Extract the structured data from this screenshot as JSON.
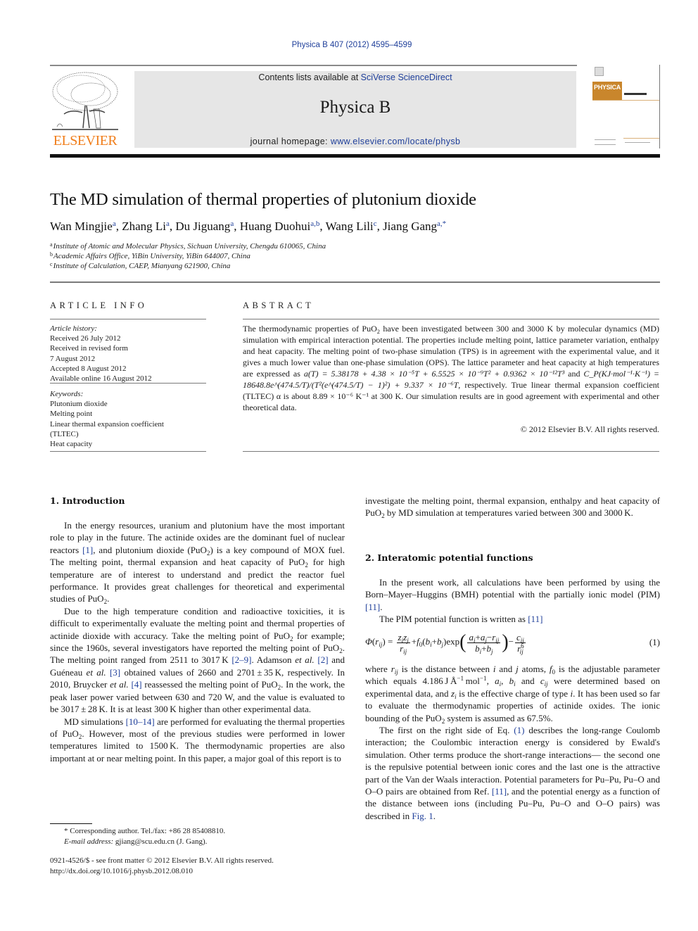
{
  "header": {
    "citation": "Physica B 407 (2012) 4595–4599",
    "contents_prefix": "Contents lists available at ",
    "contents_link": "SciVerse ScienceDirect",
    "journal_name": "Physica B",
    "homepage_prefix": "journal homepage: ",
    "homepage_link": "www.elsevier.com/locate/physb",
    "publisher_logo": "ELSEVIER",
    "cover_title": "PHYSICA"
  },
  "colors": {
    "link": "#1f3f9a",
    "elsevier_orange": "#f07e1b",
    "masthead_bg": "#e6e6e6",
    "cover_band": "#c9862c"
  },
  "article": {
    "title": "The MD simulation of thermal properties of plutonium dioxide",
    "authors": [
      {
        "name": "Wan Mingjie",
        "aff": "a"
      },
      {
        "name": "Zhang Li",
        "aff": "a"
      },
      {
        "name": "Du Jiguang",
        "aff": "a"
      },
      {
        "name": "Huang Duohui",
        "aff": "a,b"
      },
      {
        "name": "Wang Lili",
        "aff": "c"
      },
      {
        "name": "Jiang Gang",
        "aff": "a,*"
      }
    ],
    "affiliations": [
      {
        "key": "a",
        "text": "Institute of Atomic and Molecular Physics, Sichuan University, Chengdu 610065, China"
      },
      {
        "key": "b",
        "text": "Academic Affairs Office, YiBin University, YiBin 644007, China"
      },
      {
        "key": "c",
        "text": "Institute of Calculation, CAEP, Mianyang 621900, China"
      }
    ]
  },
  "article_info": {
    "heading": "ARTICLE INFO",
    "history_label": "Article history:",
    "history": [
      "Received 26 July 2012",
      "Received in revised form",
      "7 August 2012",
      "Accepted 8 August 2012",
      "Available online 16 August 2012"
    ],
    "keywords_label": "Keywords:",
    "keywords": [
      "Plutonium dioxide",
      "Melting point",
      "Linear thermal expansion coefficient",
      "(TLTEC)",
      "Heat capacity"
    ]
  },
  "abstract": {
    "heading": "ABSTRACT",
    "s1a": "The thermodynamic properties of PuO",
    "s1b": " have been investigated between 300 and 3000 K by molecular dynamics (MD) simulation with empirical interaction potential. The properties include melting point, lattice parameter variation, enthalpy and heat capacity. The melting point of two-phase simulation (TPS) is in agreement with the experimental value, and it gives a much lower value than one-phase simulation (OPS). The lattice parameter and heat capacity at high temperatures are expressed as ",
    "eq_a": "a(T) = 5.38178 + 4.38 × 10⁻⁵T + 6.5525 × 10⁻⁹T² + 0.9362 × 10⁻¹²T³",
    "and": " and ",
    "eq_cp": "C_P(KJ·mol⁻¹·K⁻¹) = 18648.8e^(474.5/T)/(T²(e^(474.5/T) − 1)²) + 9.337 × 10⁻⁶T",
    "s2": ", respectively. True linear thermal expansion coefficient (TLTEC) α is about 8.89 × 10⁻⁶ K⁻¹ at 300 K. Our simulation results are in good agreement with experimental and other theoretical data.",
    "copyright": "© 2012 Elsevier B.V. All rights reserved."
  },
  "sections": {
    "s1_heading": "1.  Introduction",
    "s2_heading": "2.  Interatomic potential functions"
  },
  "refs": {
    "r1": "[1]",
    "r2_9": "[2–9]",
    "r2": "[2]",
    "r3": "[3]",
    "r4": "[4]",
    "r10_14": "[10–14]",
    "r11": "[11]",
    "eq1": "(1)",
    "fig1": "Fig. 1"
  },
  "equation": {
    "number": "(1)"
  },
  "footnote": {
    "corresponding": "* Corresponding author. Tel./fax: +86 28 85408810.",
    "email_label": "E-mail address:",
    "email": " gjiang@scu.edu.cn (J. Gang).",
    "issn": "0921-4526/$ - see front matter © 2012 Elsevier B.V. All rights reserved.",
    "doi": "http://dx.doi.org/10.1016/j.physb.2012.08.010"
  }
}
